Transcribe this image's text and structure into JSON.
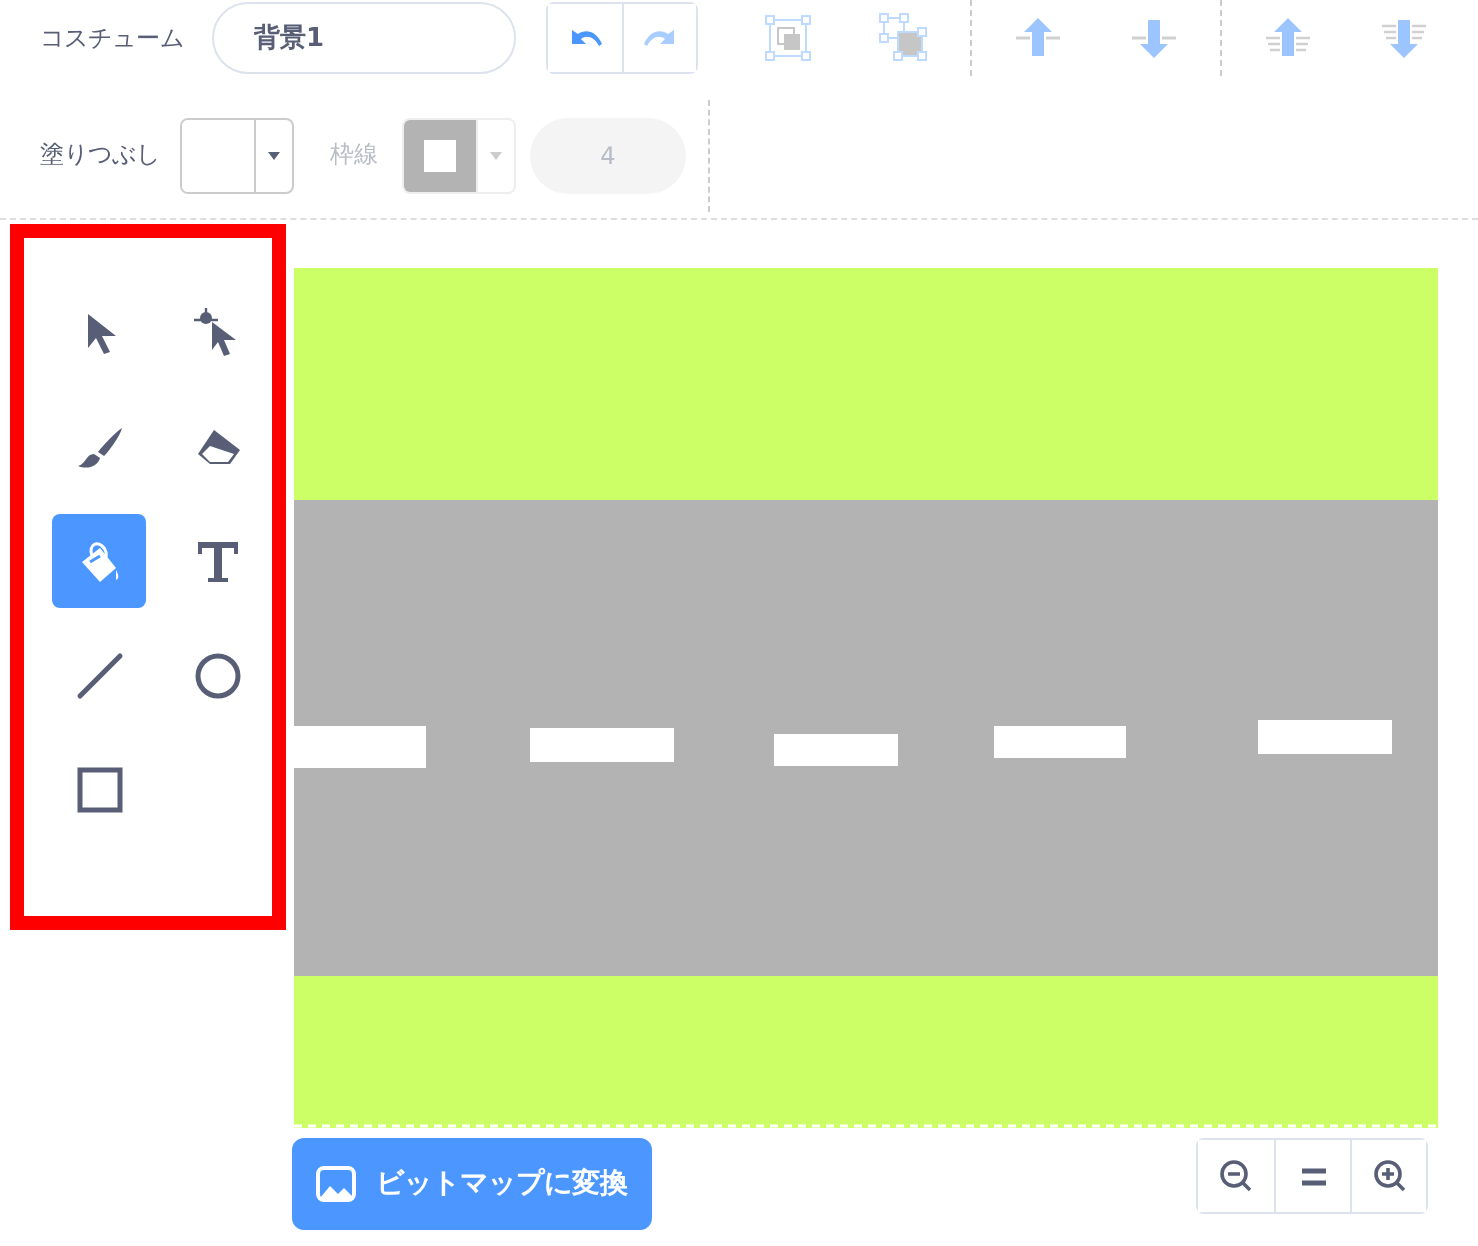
{
  "costume": {
    "label": "コスチューム",
    "name": "背景1"
  },
  "history": [
    {
      "kind": "undo",
      "disabled": false
    },
    {
      "kind": "redo",
      "disabled": true
    }
  ],
  "arrange": [
    {
      "kind": "group",
      "disabled": true
    },
    {
      "kind": "ungroup",
      "disabled": true
    },
    {
      "kind": "forward",
      "disabled": true
    },
    {
      "kind": "backward",
      "disabled": true
    },
    {
      "kind": "front",
      "disabled": true
    },
    {
      "kind": "back",
      "disabled": true
    }
  ],
  "fill": {
    "label": "塗りつぶし",
    "disabled": false
  },
  "outline": {
    "label": "枠線",
    "disabled": true
  },
  "stroke_width": {
    "value": "4",
    "disabled": true
  },
  "tools_highlighted": true,
  "tools": [
    {
      "kind": "select",
      "selected": false
    },
    {
      "kind": "reshape",
      "selected": false
    },
    {
      "kind": "brush",
      "selected": false
    },
    {
      "kind": "eraser",
      "selected": false
    },
    {
      "kind": "fill",
      "selected": true
    },
    {
      "kind": "text",
      "selected": false
    },
    {
      "kind": "line",
      "selected": false
    },
    {
      "kind": "circle",
      "selected": false
    },
    {
      "kind": "rectangle",
      "selected": false
    }
  ],
  "convert_button": {
    "label": "ビットマップに変換"
  }
}
